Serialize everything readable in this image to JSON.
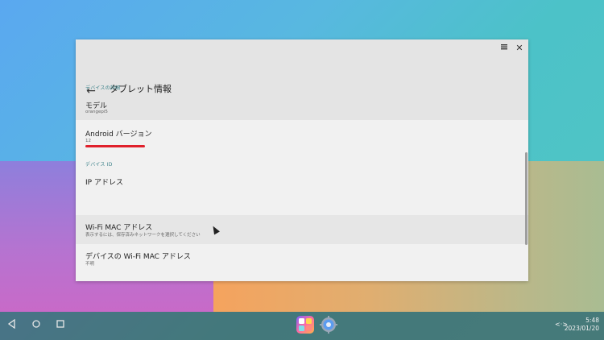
{
  "window": {
    "title": "タブレット情報",
    "controls": [
      "menu-icon",
      "close-icon"
    ]
  },
  "sections": {
    "device_details_header": "デバイスの詳細",
    "device_ids_header": "デバイス ID"
  },
  "items": {
    "model": {
      "title": "モデル",
      "subtitle": "orangepi5"
    },
    "android_version": {
      "title": "Android バージョン",
      "subtitle": "12"
    },
    "ip_address": {
      "title": "IP アドレス"
    },
    "wifi_mac": {
      "title": "Wi-Fi MAC アドレス",
      "subtitle": "表示するには、保存済みネットワークを選択してください"
    },
    "device_wifi_mac": {
      "title": "デバイスの Wi-Fi MAC アドレス",
      "subtitle": "不明"
    }
  },
  "taskbar": {
    "time": "5:48",
    "date": "2023/01/20",
    "nav": [
      "back-icon",
      "home-icon",
      "recents-icon"
    ],
    "apps": [
      "app-launcher-icon",
      "settings-gear-icon"
    ]
  },
  "colors": {
    "accent": "#3a8088",
    "highlight_underline": "#e0202b"
  }
}
